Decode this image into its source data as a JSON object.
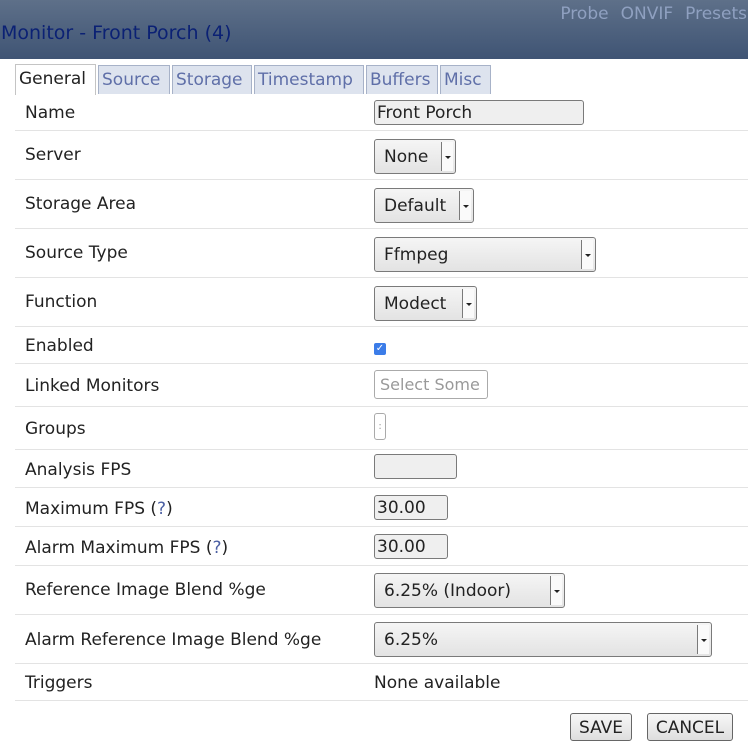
{
  "header": {
    "title": "Monitor - Front Porch (4)",
    "links": [
      "Probe",
      "ONVIF",
      "Presets"
    ]
  },
  "tabs": [
    {
      "label": "General",
      "active": true
    },
    {
      "label": "Source",
      "active": false
    },
    {
      "label": "Storage",
      "active": false
    },
    {
      "label": "Timestamp",
      "active": false
    },
    {
      "label": "Buffers",
      "active": false
    },
    {
      "label": "Misc",
      "active": false
    }
  ],
  "fields": {
    "name": {
      "label": "Name",
      "value": "Front Porch"
    },
    "server": {
      "label": "Server",
      "value": "None"
    },
    "storage_area": {
      "label": "Storage Area",
      "value": "Default"
    },
    "source_type": {
      "label": "Source Type",
      "value": "Ffmpeg"
    },
    "function": {
      "label": "Function",
      "value": "Modect"
    },
    "enabled": {
      "label": "Enabled",
      "checked": true
    },
    "linked_monitors": {
      "label": "Linked Monitors",
      "placeholder": "Select Some"
    },
    "groups": {
      "label": "Groups"
    },
    "analysis_fps": {
      "label": "Analysis FPS",
      "value": ""
    },
    "maximum_fps": {
      "label": "Maximum FPS",
      "help": "?",
      "value": "30.00"
    },
    "alarm_maximum_fps": {
      "label": "Alarm Maximum FPS",
      "help": "?",
      "value": "30.00"
    },
    "ref_blend": {
      "label": "Reference Image Blend %ge",
      "value": "6.25% (Indoor)"
    },
    "alarm_ref_blend": {
      "label": "Alarm Reference Image Blend %ge",
      "value": "6.25%"
    },
    "triggers": {
      "label": "Triggers",
      "value": "None available"
    }
  },
  "buttons": {
    "save": "SAVE",
    "cancel": "CANCEL"
  }
}
